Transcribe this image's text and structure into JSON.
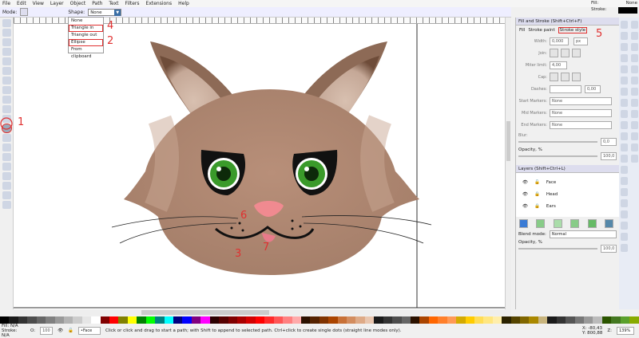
{
  "menu": [
    "File",
    "Edit",
    "View",
    "Layer",
    "Object",
    "Path",
    "Text",
    "Filters",
    "Extensions",
    "Help"
  ],
  "controls": {
    "mode_label": "Mode:",
    "shape_label": "Shape:",
    "shape_value": "None"
  },
  "shape_options": [
    "None",
    "Triangle in",
    "Triangle out",
    "Ellipse",
    "From clipboard"
  ],
  "indicator": {
    "fill_label": "Fill:",
    "fill_value": "None",
    "stroke_label": "Stroke:",
    "stroke_color": "#000000"
  },
  "fill_stroke": {
    "title": "Fill and Stroke (Shift+Ctrl+F)",
    "tabs": [
      "Fill",
      "Stroke paint",
      "Stroke style"
    ],
    "width_label": "Width:",
    "width_value": "0,000",
    "unit": "px",
    "join_label": "Join:",
    "miter_label": "Miter limit:",
    "miter_value": "4,00",
    "cap_label": "Cap:",
    "dashes_label": "Dashes:",
    "dashes_value": "0,00",
    "start_markers_label": "Start Markers:",
    "mid_markers_label": "Mid Markers:",
    "end_markers_label": "End Markers:",
    "markers_value": "None",
    "blur_label": "Blur:",
    "blur_value": "0,0",
    "opacity_label": "Opacity, %",
    "opacity_value": "100,0"
  },
  "layers": {
    "title": "Layers (Shift+Ctrl+L)",
    "items": [
      "Face",
      "Head",
      "Ears"
    ],
    "blend_label": "Blend mode:",
    "blend_value": "Normal",
    "opacity_label": "Opacity, %",
    "opacity_value": "100,0"
  },
  "status": {
    "fill_label": "Fill:",
    "stroke_label": "Stroke:",
    "fill_value": "N/A",
    "stroke_value": "N/A",
    "o_label": "O:",
    "o_value": "100",
    "layer": "•Face",
    "message": "Click or click and drag to start a path; with Shift to append to selected path. Ctrl+click to create single dots (straight line modes only).",
    "x_label": "X:",
    "x_value": "-80,43",
    "y_label": "Y:",
    "y_value": "800,88",
    "z_label": "Z:",
    "zoom": "139%"
  },
  "annotations": [
    "1",
    "2",
    "3",
    "4",
    "5",
    "6",
    "7"
  ],
  "palette": [
    "#000",
    "#1a1a1a",
    "#333",
    "#4d4d4d",
    "#666",
    "#808080",
    "#999",
    "#b3b3b3",
    "#ccc",
    "#e6e6e6",
    "#fff",
    "#800000",
    "#ff0000",
    "#808000",
    "#ffff00",
    "#008000",
    "#00ff00",
    "#008080",
    "#00ffff",
    "#000080",
    "#0000ff",
    "#800080",
    "#ff00ff",
    "#2b0000",
    "#550000",
    "#800000",
    "#aa0000",
    "#d40000",
    "#ff0000",
    "#ff2a2a",
    "#ff5555",
    "#ff8080",
    "#ffaaaa",
    "#2b1100",
    "#552200",
    "#803300",
    "#aa4400",
    "#c87137",
    "#d38d5f",
    "#deaa87",
    "#e9c6af",
    "#1a1a1a",
    "#333",
    "#4d4d4d",
    "#666",
    "#2b1100",
    "#aa4400",
    "#ff6600",
    "#ff7f2a",
    "#ff9955",
    "#d4aa00",
    "#ffcc00",
    "#ffdd55",
    "#ffe680",
    "#ffeeaa",
    "#2b2200",
    "#554400",
    "#806600",
    "#aa8800",
    "#c8b47d",
    "#1a1a1a",
    "#333",
    "#555",
    "#777",
    "#999",
    "#bbb",
    "#2b5500",
    "#447821",
    "#5aa02c",
    "#88aa00"
  ],
  "colors": {
    "fur": "#a5806b",
    "fur_dark": "#7d5a47",
    "ear_inner": "#c9ad9c",
    "eye": "#3a9a2a",
    "nose": "#f08a90",
    "annotation": "#e03030"
  }
}
